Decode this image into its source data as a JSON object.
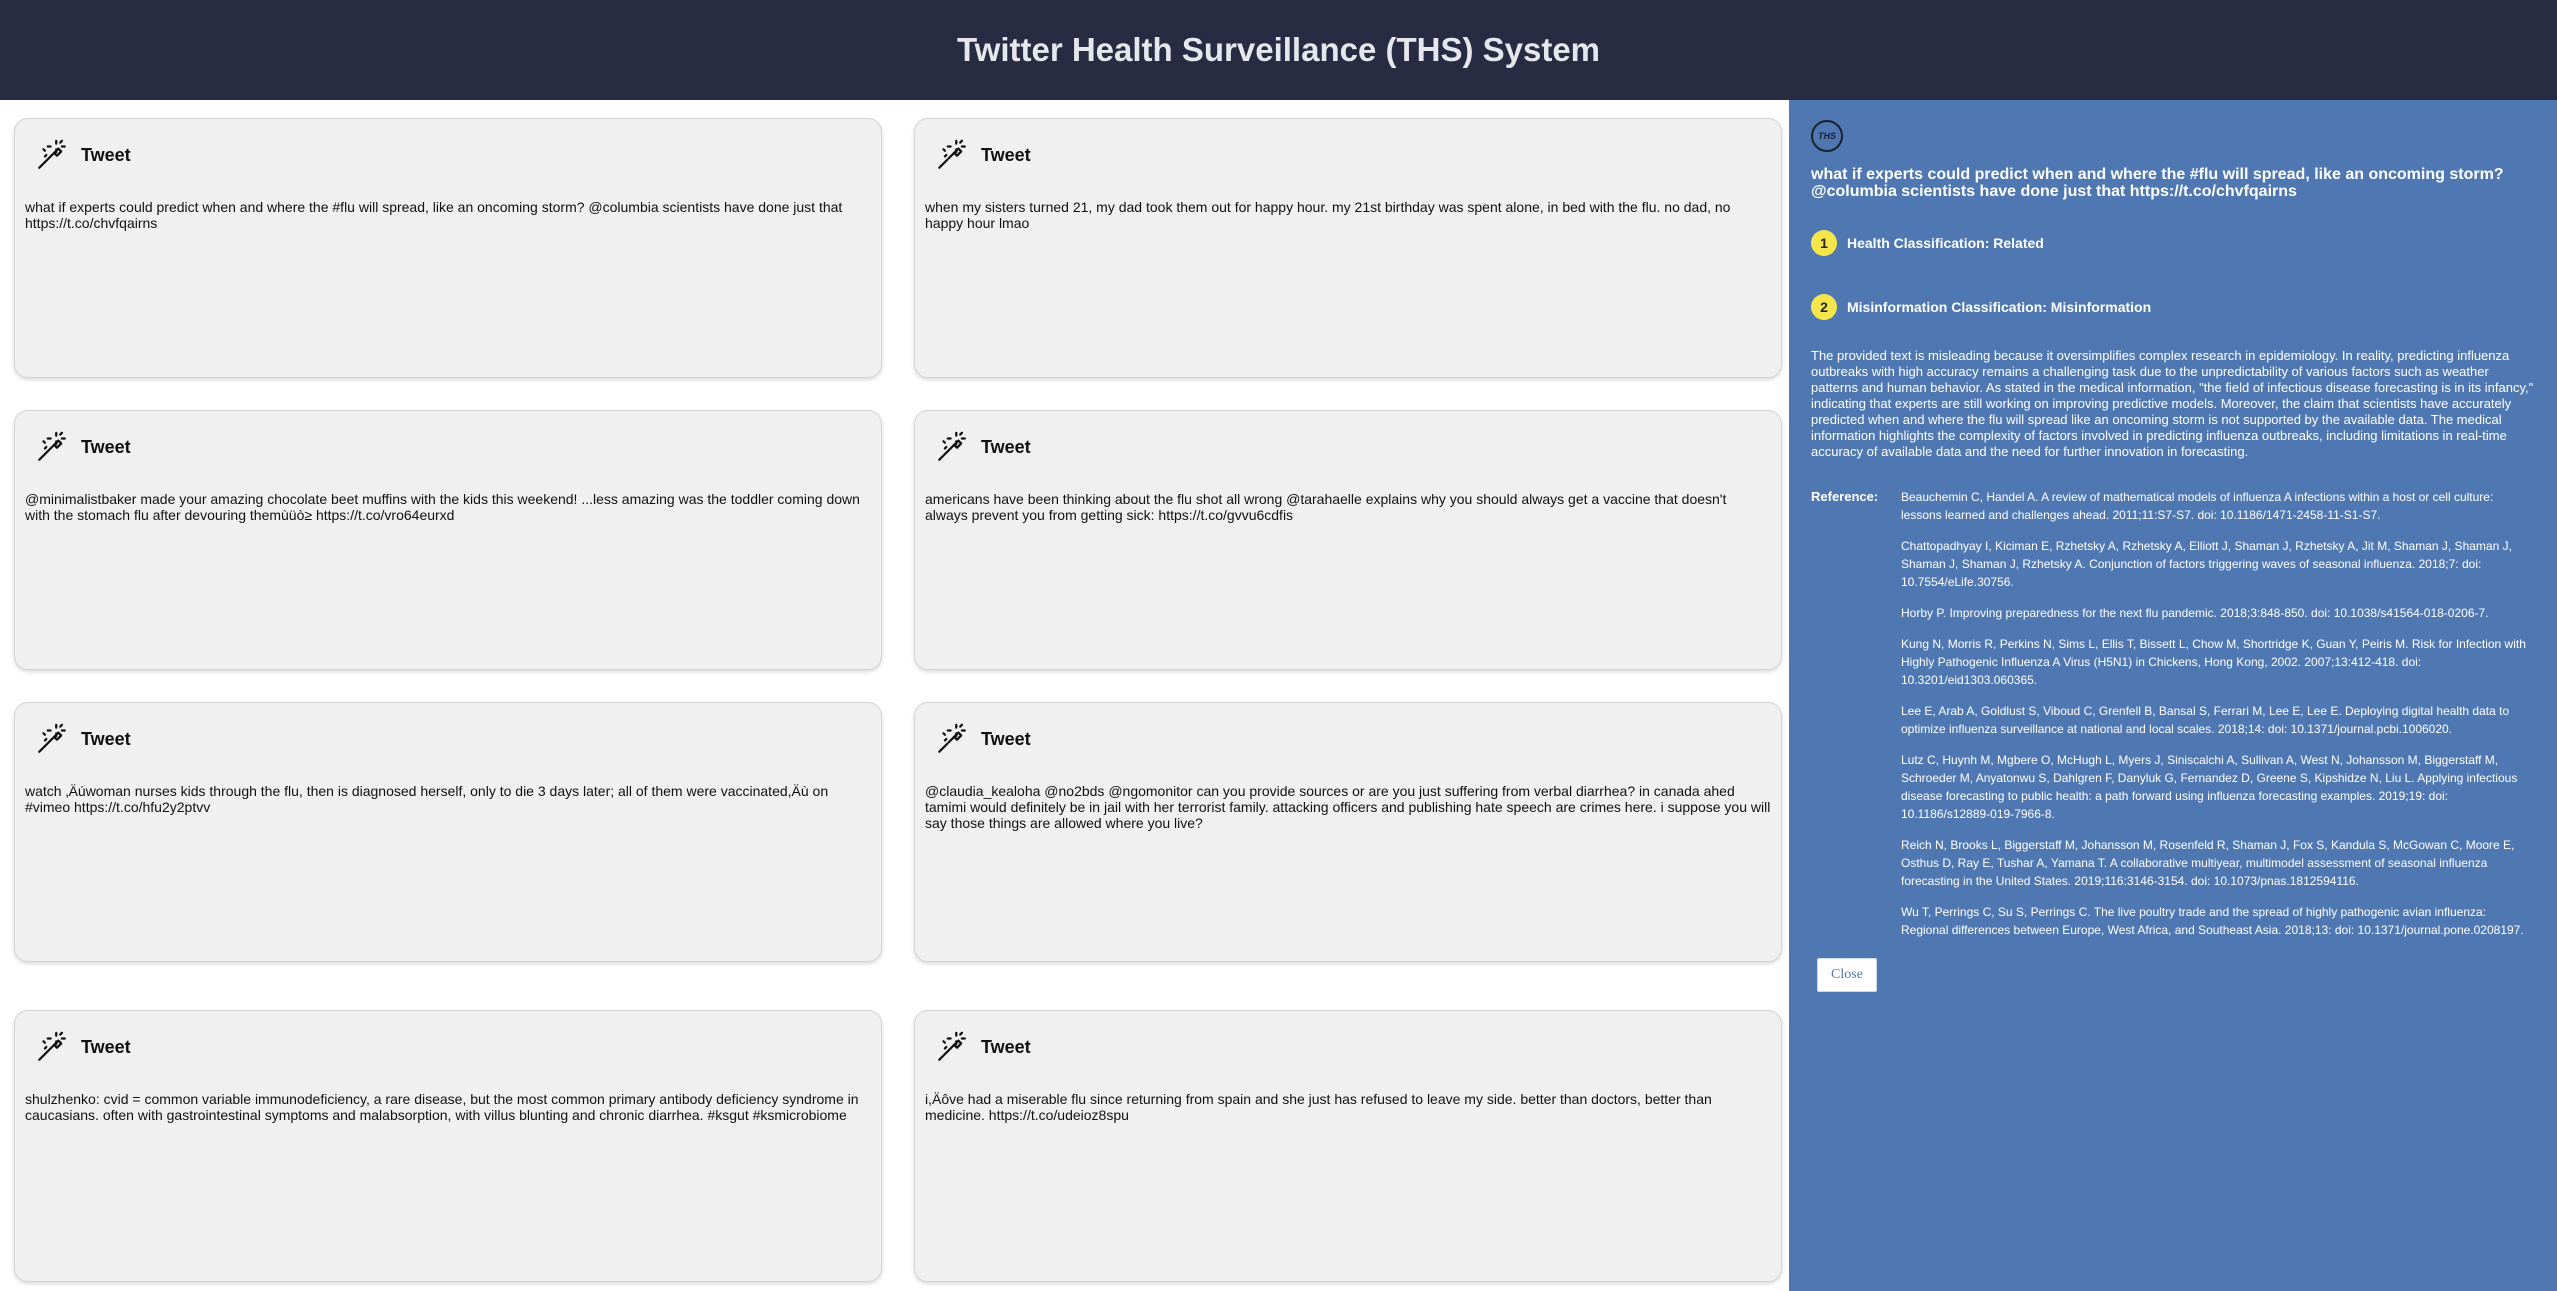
{
  "header": {
    "title": "Twitter Health Surveillance (THS) System"
  },
  "tweets": [
    {
      "label": "Tweet",
      "text": "what if experts could predict when and where the #flu will spread, like an oncoming storm? @columbia scientists have done just that https://t.co/chvfqairns"
    },
    {
      "label": "Tweet",
      "text": "when my sisters turned 21, my dad took them out for happy hour. my 21st birthday was spent alone, in bed with the flu. no dad, no happy hour lmao"
    },
    {
      "label": "Tweet",
      "text": "@minimalistbaker made your amazing chocolate beet muffins with the kids this weekend! ...less amazing was the toddler coming down with the stomach flu after devouring themùüò≥ https://t.co/vro64eurxd"
    },
    {
      "label": "Tweet",
      "text": "americans have been thinking about the flu shot all wrong @tarahaelle explains why you should always get a vaccine that doesn't always prevent you from getting sick: https://t.co/gvvu6cdfis"
    },
    {
      "label": "Tweet",
      "text": "watch ‚Äúwoman nurses kids through the flu, then is diagnosed herself, only to die 3 days later; all of them were vaccinated,Äù on #vimeo https://t.co/hfu2y2ptvv"
    },
    {
      "label": "Tweet",
      "text": "@claudia_kealoha @no2bds @ngomonitor can you provide sources or are you just suffering from verbal diarrhea? in canada ahed tamimi would definitely be in jail with her terrorist family. attacking officers and publishing hate speech are crimes here. i suppose you will say those things are allowed where you live?"
    },
    {
      "label": "Tweet",
      "text": "shulzhenko: cvid = common variable immunodeficiency, a rare disease, but the most common primary antibody deficiency syndrome in caucasians. often with gastrointestinal symptoms and malabsorption, with villus blunting and chronic diarrhea. #ksgut #ksmicrobiome"
    },
    {
      "label": "Tweet",
      "text": "i,Äôve had a miserable flu since returning from spain and she just has refused to leave my side. better than doctors, better than medicine. https://t.co/udeioz8spu"
    }
  ],
  "panel": {
    "logo": "THS",
    "tweet": "what if experts could predict when and where the #flu will spread, like an oncoming storm? @columbia scientists have done just that https://t.co/chvfqairns",
    "classifications": [
      {
        "num": "1",
        "label": "Health Classification: Related"
      },
      {
        "num": "2",
        "label": "Misinformation Classification: Misinformation"
      }
    ],
    "explanation": "The provided text is misleading because it oversimplifies complex research in epidemiology. In reality, predicting influenza outbreaks with high accuracy remains a challenging task due to the unpredictability of various factors such as weather patterns and human behavior. As stated in the medical information, \"the field of infectious disease forecasting is in its infancy,\" indicating that experts are still working on improving predictive models. Moreover, the claim that scientists have accurately predicted when and where the flu will spread like an oncoming storm is not supported by the available data. The medical information highlights the complexity of factors involved in predicting influenza outbreaks, including limitations in real-time accuracy of available data and the need for further innovation in forecasting.",
    "reference_label": "Reference:",
    "references": [
      "Beauchemin C, Handel A. A review of mathematical models of influenza A infections within a host or cell culture: lessons learned and challenges ahead. 2011;11:S7-S7. doi: 10.1186/1471-2458-11-S1-S7.",
      "Chattopadhyay I, Kiciman E, Rzhetsky A, Rzhetsky A, Elliott J, Shaman J, Rzhetsky A, Jit M, Shaman J, Shaman J, Shaman J, Shaman J, Rzhetsky A. Conjunction of factors triggering waves of seasonal influenza. 2018;7: doi: 10.7554/eLife.30756.",
      "Horby P. Improving preparedness for the next flu pandemic. 2018;3:848-850. doi: 10.1038/s41564-018-0206-7.",
      "Kung N, Morris R, Perkins N, Sims L, Ellis T, Bissett L, Chow M, Shortridge K, Guan Y, Peiris M. Risk for Infection with Highly Pathogenic Influenza A Virus (H5N1) in Chickens, Hong Kong, 2002. 2007;13:412-418. doi: 10.3201/eid1303.060365.",
      "Lee E, Arab A, Goldlust S, Viboud C, Grenfell B, Bansal S, Ferrari M, Lee E, Lee E. Deploying digital health data to optimize influenza surveillance at national and local scales. 2018;14: doi: 10.1371/journal.pcbi.1006020.",
      "Lutz C, Huynh M, Mgbere O, McHugh L, Myers J, Siniscalchi A, Sullivan A, West N, Johansson M, Biggerstaff M, Schroeder M, Anyatonwu S, Dahlgren F, Danyluk G, Fernandez D, Greene S, Kipshidze N, Liu L. Applying infectious disease forecasting to public health: a path forward using influenza forecasting examples. 2019;19: doi: 10.1186/s12889-019-7966-8.",
      "Reich N, Brooks L, Biggerstaff M, Johansson M, Rosenfeld R, Shaman J, Fox S, Kandula S, McGowan C, Moore E, Osthus D, Ray E, Tushar A, Yamana T. A collaborative multiyear, multimodel assessment of seasonal influenza forecasting in the United States. 2019;116:3146-3154. doi: 10.1073/pnas.1812594116.",
      "Wu T, Perrings C, Su S, Perrings C. The live poultry trade and the spread of highly pathogenic avian influenza: Regional differences between Europe, West Africa, and Southeast Asia. 2018;13: doi: 10.1371/journal.pone.0208197."
    ],
    "close_label": "Close"
  }
}
